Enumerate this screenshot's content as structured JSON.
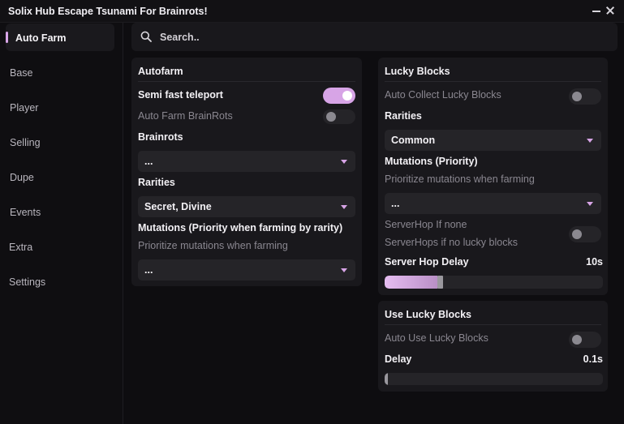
{
  "window": {
    "title": "Solix Hub Escape Tsunami For Brainrots!"
  },
  "sidebar": {
    "items": [
      {
        "label": "Auto Farm"
      },
      {
        "label": "Base"
      },
      {
        "label": "Player"
      },
      {
        "label": "Selling"
      },
      {
        "label": "Dupe"
      },
      {
        "label": "Events"
      },
      {
        "label": "Extra"
      },
      {
        "label": "Settings"
      }
    ],
    "active": "Auto Farm"
  },
  "search": {
    "placeholder": "Search.."
  },
  "autofarm": {
    "title": "Autofarm",
    "semi_fast_teleport": {
      "label": "Semi fast teleport",
      "enabled": true
    },
    "auto_farm_brainrots": {
      "label": "Auto Farm BrainRots",
      "enabled": false
    },
    "brainrots": {
      "label": "Brainrots",
      "value": "..."
    },
    "rarities": {
      "label": "Rarities",
      "value": "Secret, Divine"
    },
    "mutations": {
      "label": "Mutations (Priority when farming by rarity)",
      "hint": "Prioritize mutations when farming",
      "value": "..."
    }
  },
  "lucky_blocks": {
    "title": "Lucky Blocks",
    "auto_collect": {
      "label": "Auto Collect Lucky Blocks",
      "enabled": false
    },
    "rarities": {
      "label": "Rarities",
      "value": "Common"
    },
    "mutations": {
      "label": "Mutations (Priority)",
      "hint": "Prioritize mutations when farming",
      "value": "..."
    },
    "serverhop": {
      "label": "ServerHop If none",
      "hint": "ServerHops if no lucky blocks",
      "enabled": false
    },
    "server_hop_delay": {
      "label": "Server Hop Delay",
      "value": "10s",
      "fraction": 0.24
    }
  },
  "use_lucky_blocks": {
    "title": "Use Lucky Blocks",
    "auto_use": {
      "label": "Auto Use Lucky Blocks",
      "enabled": false
    },
    "delay": {
      "label": "Delay",
      "value": "0.1s",
      "fraction": 0.0
    }
  },
  "colors": {
    "accent": "#d7a4e6",
    "panel": "#19181c",
    "background": "#0e0d10"
  },
  "icons": {
    "search": "search-icon",
    "minimize": "minimize-icon",
    "close": "close-icon",
    "dropdown": "chevron-down-icon"
  }
}
